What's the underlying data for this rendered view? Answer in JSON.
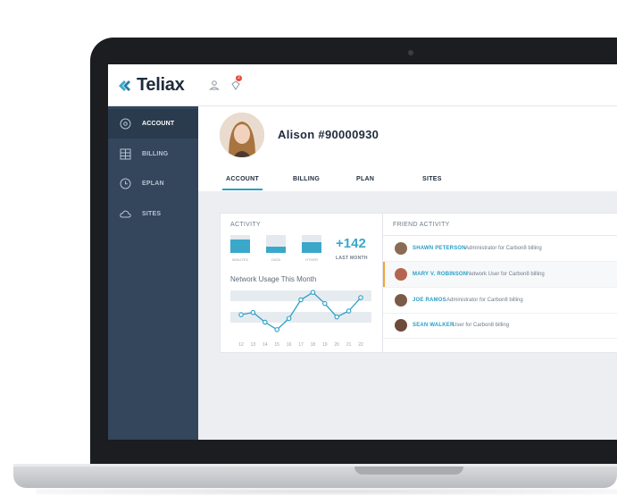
{
  "app": {
    "logo_text": "Teliax",
    "notifications_count": "2",
    "colors": {
      "accent": "#3ba7c9",
      "sidebar": "#33465b",
      "sidebar_active": "#2a3b4e",
      "highlight_bar": "#f0a23a"
    }
  },
  "sidebar": {
    "items": [
      {
        "label": "ACCOUNT",
        "icon": "account-circle-icon",
        "active": true
      },
      {
        "label": "BILLING",
        "icon": "billing-grid-icon",
        "active": false
      },
      {
        "label": "EPLAN",
        "icon": "clock-icon",
        "active": false
      },
      {
        "label": "SITES",
        "icon": "cloud-icon",
        "active": false
      }
    ]
  },
  "profile": {
    "name": "Alison #90000930"
  },
  "tabs": [
    {
      "label": "ACCOUNT",
      "active": true
    },
    {
      "label": "BILLING",
      "active": false
    },
    {
      "label": "PLAN",
      "active": false
    },
    {
      "label": "SITES",
      "active": false
    }
  ],
  "activity": {
    "title": "ACTIVITY",
    "stats": [
      {
        "label": "MINUTES",
        "fill": 0.75
      },
      {
        "label": "DATA",
        "fill": 0.35
      },
      {
        "label": "OTHER",
        "fill": 0.6
      }
    ],
    "total": "+142",
    "total_label": "LAST MONTH"
  },
  "chart_data": {
    "type": "line",
    "title": "Network Usage This Month",
    "x": [
      12,
      13,
      14,
      15,
      16,
      17,
      18,
      19,
      20,
      21,
      22
    ],
    "values": [
      25,
      28,
      15,
      5,
      20,
      45,
      55,
      40,
      22,
      30,
      48
    ],
    "ylim": [
      0,
      60
    ],
    "grid": true
  },
  "friends": {
    "title": "FRIEND ACTIVITY",
    "items": [
      {
        "name": "SHAWN PETERSON",
        "desc": "Administrator for Carbon8 billing",
        "highlight": false
      },
      {
        "name": "MARY V. ROBINSON",
        "desc": "Network User for Carbon8 billing",
        "highlight": true
      },
      {
        "name": "JOE RAMOS",
        "desc": "Administrator for Carbon8 billing",
        "highlight": false
      },
      {
        "name": "SEAN WALKER",
        "desc": "User for Carbon8 billing",
        "highlight": false
      }
    ]
  }
}
